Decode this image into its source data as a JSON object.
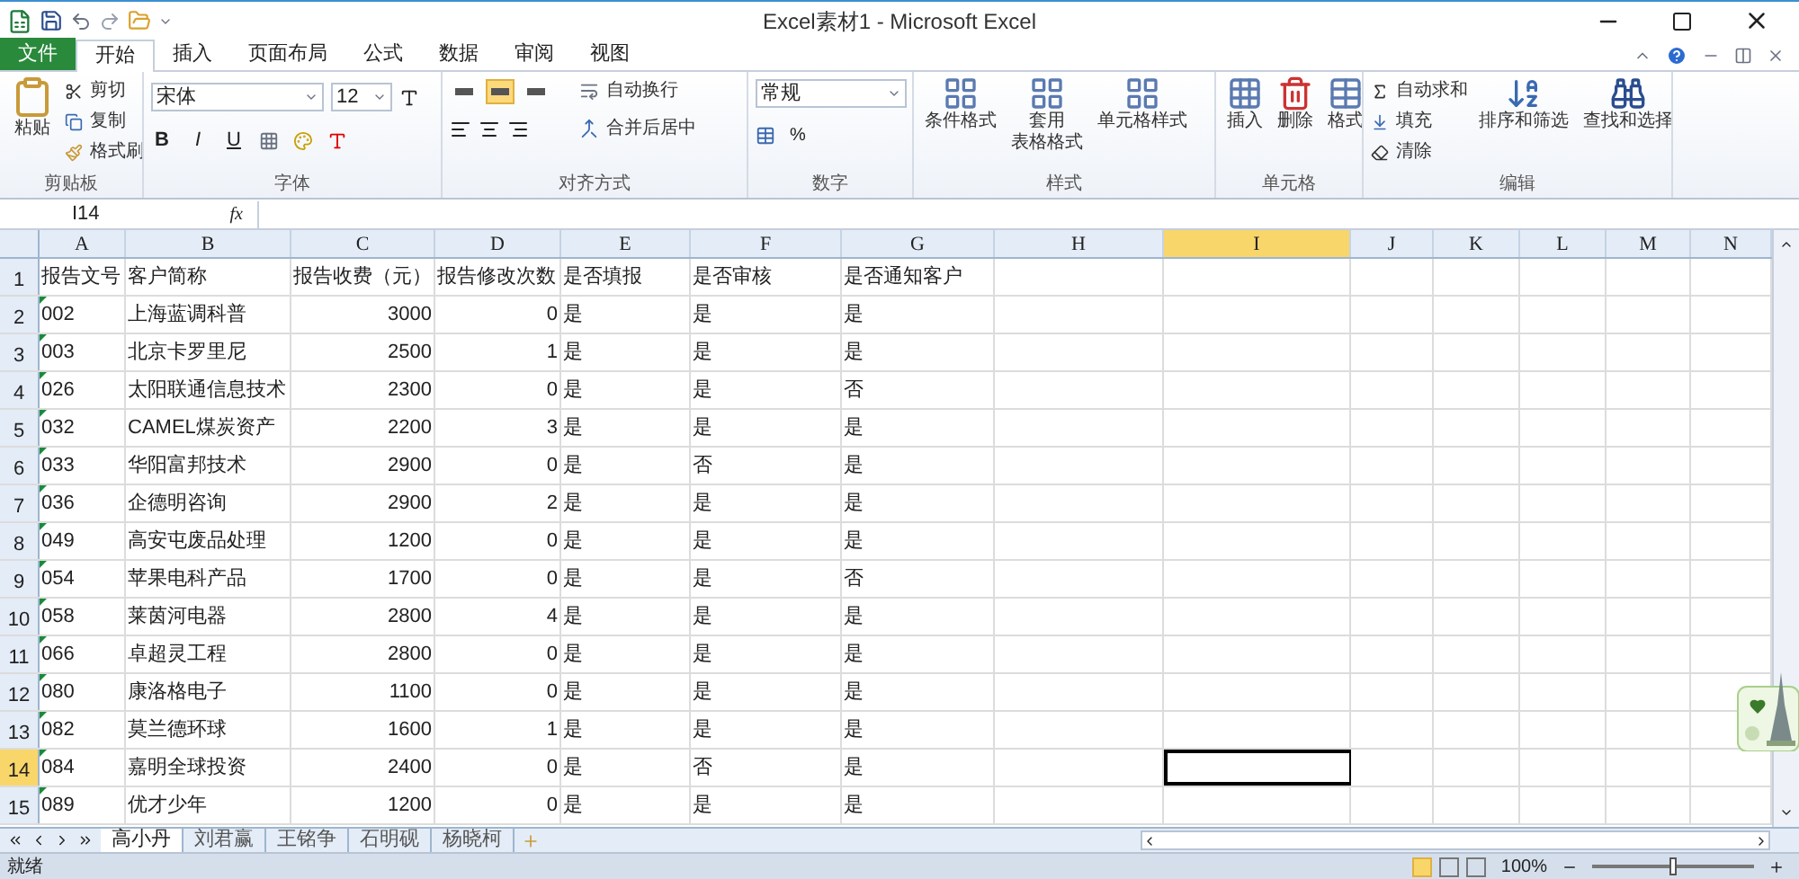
{
  "window": {
    "title": "Excel素材1 - Microsoft Excel"
  },
  "ribbon_tabs": [
    {
      "label": "文件",
      "kind": "file",
      "selected": false
    },
    {
      "label": "开始",
      "kind": "tab",
      "selected": true
    },
    {
      "label": "插入",
      "kind": "tab",
      "selected": false
    },
    {
      "label": "页面布局",
      "kind": "tab",
      "selected": false
    },
    {
      "label": "公式",
      "kind": "tab",
      "selected": false
    },
    {
      "label": "数据",
      "kind": "tab",
      "selected": false
    },
    {
      "label": "审阅",
      "kind": "tab",
      "selected": false
    },
    {
      "label": "视图",
      "kind": "tab",
      "selected": false
    }
  ],
  "clipboard": {
    "label": "剪贴板",
    "paste": "粘贴",
    "items": [
      "剪切",
      "复制",
      "格式刷"
    ]
  },
  "font": {
    "label": "字体",
    "font_name": "宋体",
    "font_size": "12",
    "styles": [
      "B",
      "I",
      "U"
    ]
  },
  "alignment": {
    "label": "对齐方式",
    "vertical": [
      {
        "selected": false
      },
      {
        "selected": true
      },
      {
        "selected": false
      }
    ],
    "wrap": "自动换行",
    "merge": "合并后居中"
  },
  "number": {
    "label": "数字",
    "format": "常规",
    "percent": "%"
  },
  "styles": {
    "label": "样式",
    "items": [
      {
        "lines": [
          "条件格式"
        ]
      },
      {
        "lines": [
          "套用",
          "表格格式"
        ]
      },
      {
        "lines": [
          "单元格样式"
        ]
      }
    ]
  },
  "cells": {
    "label": "单元格",
    "items": [
      "插入",
      "删除",
      "格式"
    ]
  },
  "editing": {
    "label": "编辑",
    "small": [
      "自动求和",
      "填充",
      "清除"
    ],
    "big": [
      "排序和筛选",
      "查找和选择"
    ]
  },
  "name_box": "I14",
  "function_label": "fx",
  "columns": [
    {
      "label": "A",
      "selected": false
    },
    {
      "label": "B",
      "selected": false
    },
    {
      "label": "C",
      "selected": false
    },
    {
      "label": "D",
      "selected": false
    },
    {
      "label": "E",
      "selected": false
    },
    {
      "label": "F",
      "selected": false
    },
    {
      "label": "G",
      "selected": false
    },
    {
      "label": "H",
      "selected": false
    },
    {
      "label": "I",
      "selected": true
    },
    {
      "label": "J",
      "selected": false
    },
    {
      "label": "K",
      "selected": false
    },
    {
      "label": "L",
      "selected": false
    },
    {
      "label": "M",
      "selected": false
    },
    {
      "label": "N",
      "selected": false
    }
  ],
  "rows": [
    {
      "number": "1",
      "selected": false,
      "flag": false,
      "cells": [
        "报告文号",
        "客户简称",
        "报告收费（元）",
        "报告修改次数",
        "是否填报",
        "是否审核",
        "是否通知客户"
      ]
    },
    {
      "number": "2",
      "selected": false,
      "flag": true,
      "cells": [
        "002",
        "上海蓝调科普",
        "3000",
        "0",
        "是",
        "是",
        "是"
      ]
    },
    {
      "number": "3",
      "selected": false,
      "flag": true,
      "cells": [
        "003",
        "北京卡罗里尼",
        "2500",
        "1",
        "是",
        "是",
        "是"
      ]
    },
    {
      "number": "4",
      "selected": false,
      "flag": true,
      "cells": [
        "026",
        "太阳联通信息技术",
        "2300",
        "0",
        "是",
        "是",
        "否"
      ]
    },
    {
      "number": "5",
      "selected": false,
      "flag": true,
      "cells": [
        "032",
        "CAMEL煤炭资产",
        "2200",
        "3",
        "是",
        "是",
        "是"
      ]
    },
    {
      "number": "6",
      "selected": false,
      "flag": true,
      "cells": [
        "033",
        "华阳富邦技术",
        "2900",
        "0",
        "是",
        "否",
        "是"
      ]
    },
    {
      "number": "7",
      "selected": false,
      "flag": true,
      "cells": [
        "036",
        "企德明咨询",
        "2900",
        "2",
        "是",
        "是",
        "是"
      ]
    },
    {
      "number": "8",
      "selected": false,
      "flag": true,
      "cells": [
        "049",
        "高安屯废品处理",
        "1200",
        "0",
        "是",
        "是",
        "是"
      ]
    },
    {
      "number": "9",
      "selected": false,
      "flag": true,
      "cells": [
        "054",
        "苹果电科产品",
        "1700",
        "0",
        "是",
        "是",
        "否"
      ]
    },
    {
      "number": "10",
      "selected": false,
      "flag": true,
      "cells": [
        "058",
        "莱茵河电器",
        "2800",
        "4",
        "是",
        "是",
        "是"
      ]
    },
    {
      "number": "11",
      "selected": false,
      "flag": true,
      "cells": [
        "066",
        "卓超灵工程",
        "2800",
        "0",
        "是",
        "是",
        "是"
      ]
    },
    {
      "number": "12",
      "selected": false,
      "flag": true,
      "cells": [
        "080",
        "康洛格电子",
        "1100",
        "0",
        "是",
        "是",
        "是"
      ]
    },
    {
      "number": "13",
      "selected": false,
      "flag": true,
      "cells": [
        "082",
        "莫兰德环球",
        "1600",
        "1",
        "是",
        "是",
        "是"
      ]
    },
    {
      "number": "14",
      "selected": true,
      "flag": true,
      "cells": [
        "084",
        "嘉明全球投资",
        "2400",
        "0",
        "是",
        "否",
        "是"
      ]
    },
    {
      "number": "15",
      "selected": false,
      "flag": true,
      "cells": [
        "089",
        "优才少年",
        "1200",
        "0",
        "是",
        "是",
        "是"
      ]
    }
  ],
  "sheet_tabs": [
    {
      "label": "高小丹",
      "selected": true
    },
    {
      "label": "刘君赢",
      "selected": false
    },
    {
      "label": "王铭争",
      "selected": false
    },
    {
      "label": "石明砚",
      "selected": false
    },
    {
      "label": "杨晓柯",
      "selected": false
    }
  ],
  "status_bar": {
    "text": "就绪",
    "zoom": "100%",
    "level": 0.5,
    "views": [
      {
        "selected": true
      },
      {
        "selected": false
      },
      {
        "selected": false
      }
    ]
  }
}
